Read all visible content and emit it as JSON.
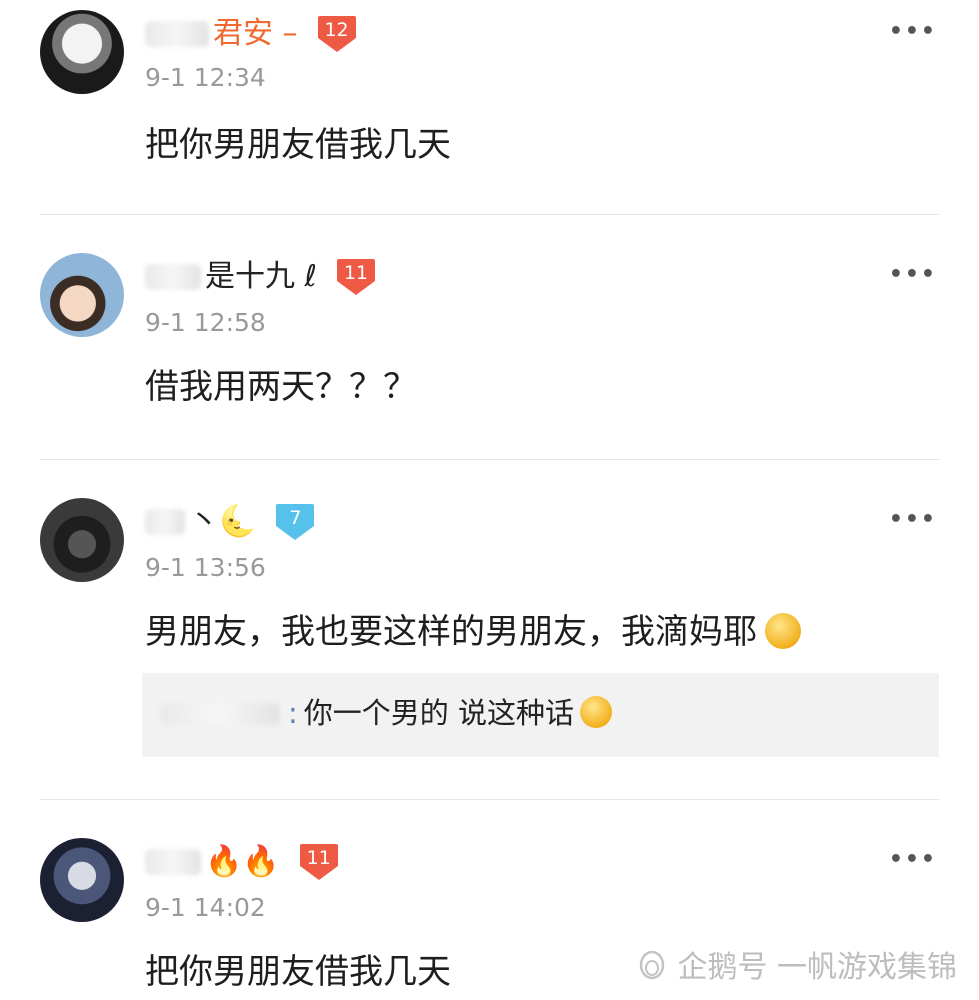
{
  "colors": {
    "badge_orange": "#ef5a45",
    "badge_blue": "#56c1ea",
    "name_orange": "#f06a30",
    "time_gray": "#999999",
    "reply_bg": "#f2f2f2"
  },
  "comments": [
    {
      "username": "君安 –",
      "level": "12",
      "level_color": "#ef5a45",
      "time": "9-1 12:34",
      "text": "把你男朋友借我几天",
      "more": "•••"
    },
    {
      "username": "是十九 ℓ",
      "level": "11",
      "level_color": "#ef5a45",
      "time": "9-1 12:58",
      "text": "借我用两天？？？",
      "more": "•••"
    },
    {
      "username": "丶🌜",
      "level": "7",
      "level_color": "#56c1ea",
      "time": "9-1 13:56",
      "text": "男朋友，我也要这样的男朋友，我滴妈耶",
      "emoji": "sick-face-emoji",
      "reply": {
        "colon": ":",
        "text": "你一个男的 说这种话",
        "emoji": "smile-face-emoji"
      },
      "more": "•••"
    },
    {
      "username": "🔥🔥",
      "level": "11",
      "level_color": "#ef5a45",
      "time": "9-1 14:02",
      "text": "把你男朋友借我几天",
      "more": "•••"
    }
  ],
  "watermark": {
    "text": "企鹅号 一帆游戏集锦",
    "icon": "penguin-icon"
  }
}
